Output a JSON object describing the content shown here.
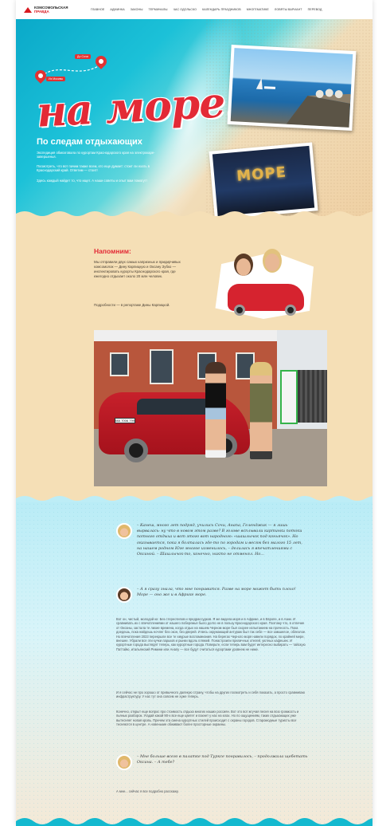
{
  "header": {
    "logo_line1": "КОМСОМОЛЬСКАЯ",
    "logo_line2": "ПРАВДА",
    "nav": [
      "ГЛАВНОЕ",
      "АДМИНКА",
      "ЗАКОНЫ",
      "ТЕРМИНАЛЫ",
      "ЧАС ОДОЛЬСКО",
      "КАЛЕНДАРЬ ПРАЗДНИКОВ",
      "МНОГЕМАТИКЕ",
      "ЛОВЯТЫ ВАРИАНТ",
      "ПЕРЕВОД"
    ]
  },
  "hero": {
    "pin_from": "Из Москвы",
    "pin_to": "До Сочи",
    "title": "на море!",
    "subtitle": "По следам отдыхающих",
    "p1": "Экспедиция обмозговала по курортам Краснодарского края на электрокаре-завершенья.",
    "p2": "Посмотреть, что вот пачим также всем, кто еще думает: стоит ли ехать в Краснодарский край. Ответим — стоит!",
    "p3": "Здесь каждый найдет то, что ищет. А наши советы и опыт вам помогут!",
    "sign": "МОРЕ"
  },
  "remind": {
    "title": "Напомним:",
    "p1": "Мы отправили двух самых капризных и придирчивых комсомолок — Дину Карпицкую и Оксану Зубко — инспектировать курорты Краснодарского края, где ежегодно отдыхает около 20 млн человек.",
    "p2": "Подробности — в репортаже Дины Карпицкой.",
    "plate": "МА 7006 799"
  },
  "dialog": {
    "q1": "– Канеш, много лет подряд, учились Сочи, Анапа, Геленджик — я лишь вырвалась: ну что в новом этом разве? В голове всплывали картинки потоки потного отдыха и вот этого вот народного: «шашлычок под коньячок». Но оказывается, пока я болталась где-то по городам и весям без малого 15 лет, на нашем родном Юге многое изменилось, – делилась я впечатлениями с Оксаной. – Шашлычок-то, конечно, никто не отменял. Но...",
    "q2": "– А я сразу знала, что мне понравится. Разве на море может быть плохо! Море — оно же и в Африке море.",
    "p1": "Вот он, чистый, молодой юг. Без стереотипов и предрассудков. Я же видела моря и в Африке, и в Европе, и в Азии. И сравнивать их с впечатлениями от нашего побережья было долго не в пользу Краснодарского края. Поэтому что, в отличие от Оксаны, застала те лихие времена, когда отдых на нашем Черном море был скорее испытанием на прочность. Пока доедешь, пока найдешь ночлег без окон, без дверей. И весь окружающий антураж был так себе — все замшелое, облезлое. Но впечатления 2023 перекрыли все те хмурые воспоминания. На берегах Черного моря навели порядок, по крайней мере, внешне. Убрали все эти кучки ларьков и рынки вдоль пляжей. Понастроили приличных отелей, уютных кафешек. И курортные города выглядят теперь, как курортные города. Поверьте, если теперь вам будет интересно выбирать — тайскую Паттайю, итальянский Римини или Анапу — все будут считаться курортами уровнем не ниже.",
    "p2": "И я сейчас не про хорошо от привычного далекую страну, чтобы на других посмотреть и себя показать, а просто сравниваю инфраструктуру. У нас тут она совсем не хуже теперь.",
    "p3": "Конечно, открыт еще вопрос про стоимость отдыха многих наших россиян. Вот это вот жгучая песня на всю громкость и пьяных разборок. Угадай какой 90-х все еще цветет и пахнет у нас на югах. Но по ощущениям, таких отдыхающих уже вытесняет новая кровь. Причем эта смена курортных стилей происходит с охраны городов. Старомодные туристы все тесняются в центре. А новенькие обживают более просторные окраины.",
    "q3": "– Мне больше всего в палатке под Турксе понравилось, – продолжала щебетать Оксана. – А тебе?",
    "p4": "А мне... сейчас я все подробно расскажу."
  },
  "colors": {
    "accent": "#e32a36",
    "sand": "#f5dfb6",
    "sea": "#1cc1d8"
  }
}
